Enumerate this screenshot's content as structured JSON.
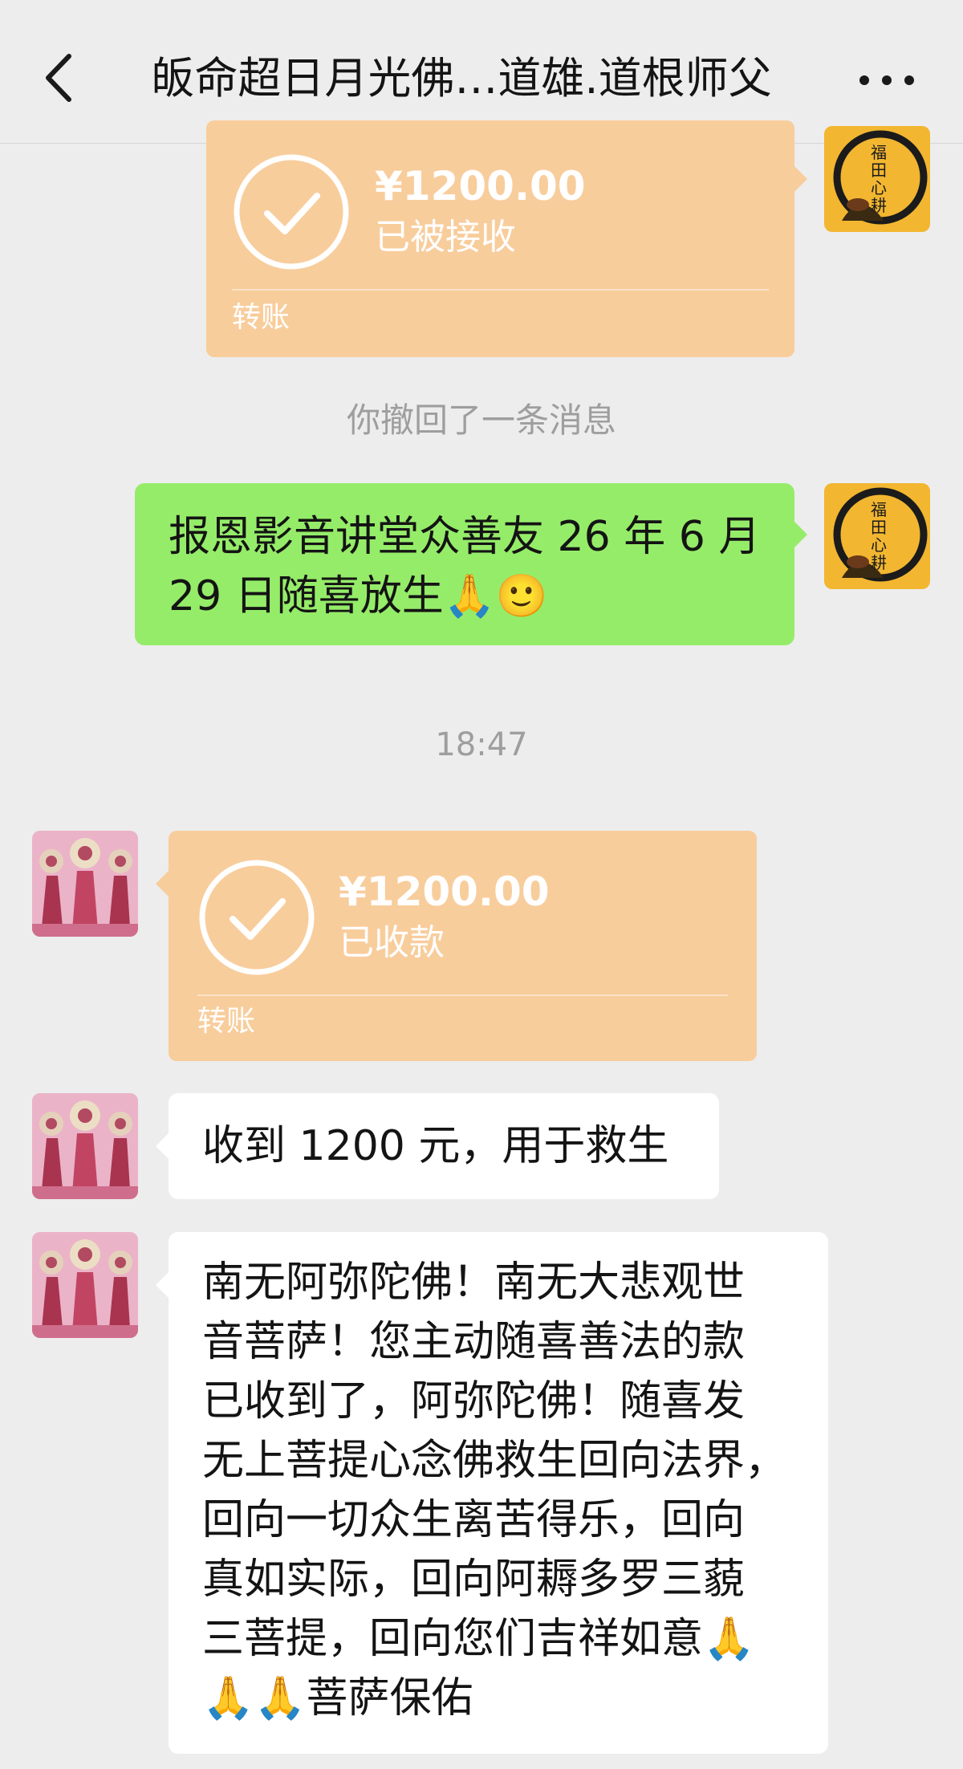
{
  "header": {
    "title": "皈命超日月光佛…道雄.道根师父"
  },
  "messages": {
    "transfer_sent": {
      "amount": "¥1200.00",
      "status": "已被接收",
      "label": "转账"
    },
    "recall_notice": "你撤回了一条消息",
    "sent_text": {
      "line1": "报恩影音讲堂众善友 26 年 6 月",
      "line2": "29 日随喜放生🙏🙂"
    },
    "timestamp": "18:47",
    "transfer_received": {
      "amount": "¥1200.00",
      "status": "已收款",
      "label": "转账"
    },
    "reply_short": "收到 1200 元，用于救生",
    "reply_long": {
      "lines": [
        "南无阿弥陀佛！南无大悲观世",
        "音菩萨！您主动随喜善法的款",
        "已收到了，阿弥陀佛！随喜发",
        "无上菩提心念佛救生回向法界，",
        "回向一切众生离苦得乐，回向",
        "真如实际，回向阿耨多罗三藐",
        "三菩提，回向您们吉祥如意🙏",
        "🙏🙏菩萨保佑"
      ]
    }
  },
  "avatars": {
    "self_logo_text": [
      "福",
      "田",
      "心",
      "耕"
    ]
  },
  "colors": {
    "background": "#ededed",
    "transfer_orange": "#f8cd9c",
    "sent_bubble_green": "#95ec69",
    "received_bubble_white": "#ffffff",
    "system_text_gray": "#9e9e9e"
  },
  "icons": [
    "back-arrow-icon",
    "more-dots-icon",
    "check-circle-icon"
  ]
}
